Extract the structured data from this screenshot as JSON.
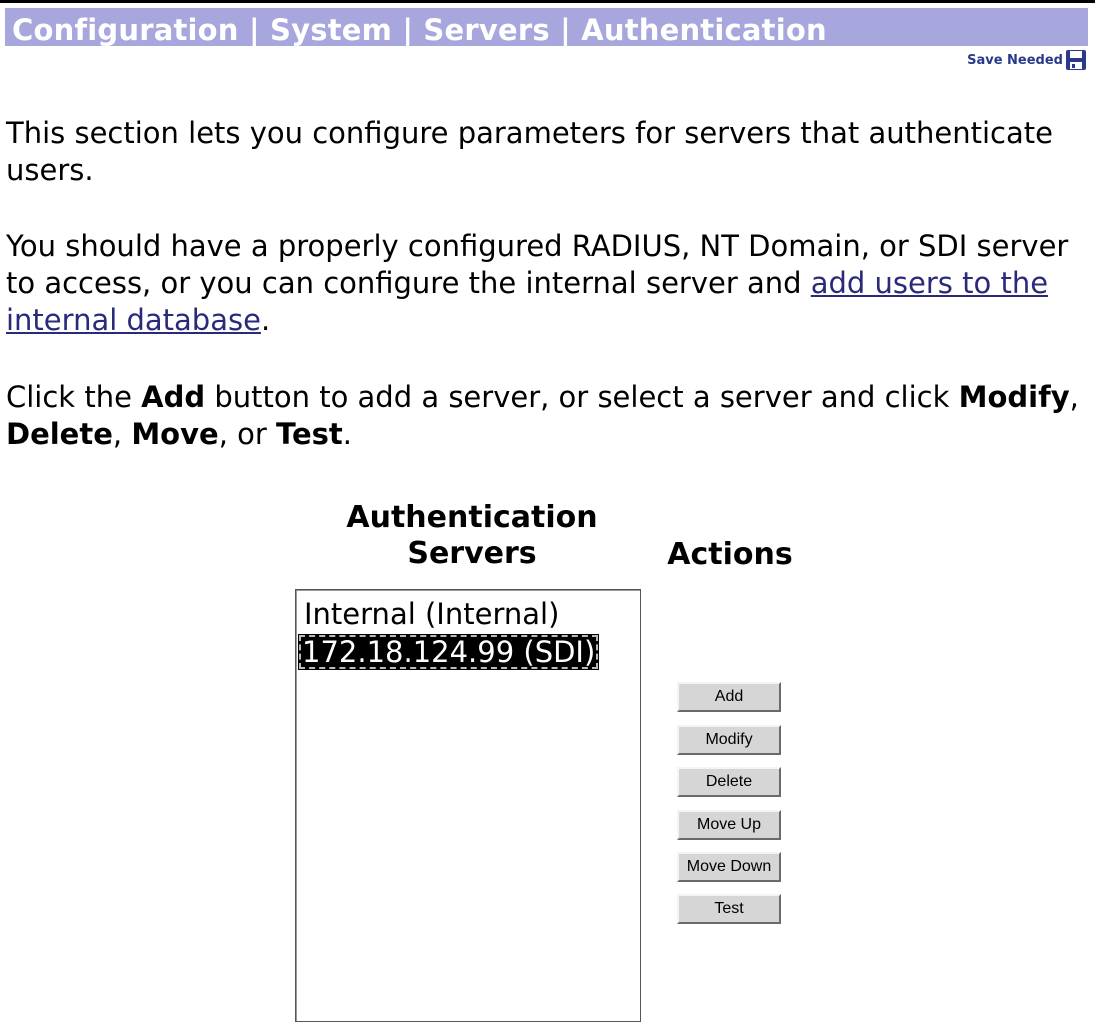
{
  "header": {
    "title": "Configuration | System | Servers | Authentication",
    "save_needed_label": "Save Needed",
    "save_icon": "floppy-disk-icon"
  },
  "intro": {
    "p1": "This section lets you configure parameters for servers that authenticate users.",
    "p2_before_link": "You should have a properly configured RADIUS, NT Domain, or SDI server to access, or you can configure the internal server and ",
    "p2_link": "add users to the internal database",
    "p2_after_link": ".",
    "p3_part1": "Click the ",
    "p3_add": "Add",
    "p3_part2": " button to add a server, or select a server and click ",
    "p3_modify": "Modify",
    "p3_sep1": ", ",
    "p3_delete": "Delete",
    "p3_sep2": ", ",
    "p3_move": "Move",
    "p3_sep3": ", or ",
    "p3_test": "Test",
    "p3_end": "."
  },
  "servers": {
    "heading_line1": "Authentication",
    "heading_line2": "Servers",
    "items": [
      {
        "label": "Internal (Internal)",
        "selected": false
      },
      {
        "label": "172.18.124.99 (SDI)",
        "selected": true
      }
    ]
  },
  "actions": {
    "heading": "Actions",
    "buttons": [
      "Add",
      "Modify",
      "Delete",
      "Move Up",
      "Move Down",
      "Test"
    ]
  },
  "colors": {
    "title_bar_bg": "#a7a7de",
    "title_text": "#ffffff",
    "link": "#2a2a7a",
    "selected_bg": "#000000",
    "button_face": "#d6d6d6"
  }
}
